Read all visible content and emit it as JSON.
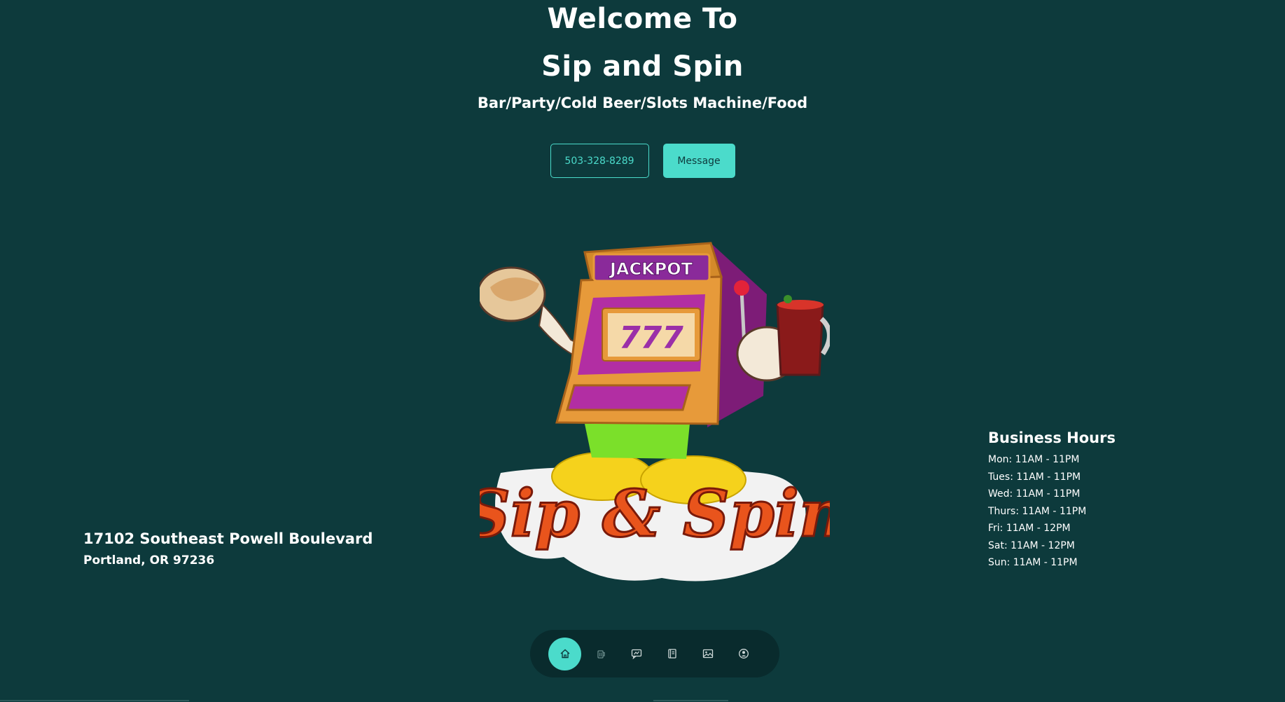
{
  "hero": {
    "title_line1": "Welcome To",
    "title_line2": "Sip and Spin",
    "subtitle": "Bar/Party/Cold Beer/Slots Machine/Food"
  },
  "cta": {
    "phone_label": "503-328-8289",
    "message_label": "Message"
  },
  "logo": {
    "marquee_text": "JACKPOT",
    "reel_text": "777",
    "wordmark": "Sip & Spin"
  },
  "address": {
    "street": "17102 Southeast Powell Boulevard",
    "city": "Portland, OR 97236"
  },
  "hours": {
    "title": "Business Hours",
    "items": [
      "Mon: 11AM - 11PM",
      "Tues: 11AM - 11PM",
      "Wed: 11AM - 11PM",
      "Thurs: 11AM - 11PM",
      "Fri: 11AM - 12PM",
      "Sat: 11AM - 12PM",
      "Sun: 11AM - 11PM"
    ]
  },
  "nav": {
    "items": [
      {
        "icon": "home-icon",
        "active": true
      },
      {
        "icon": "beer-mug-icon",
        "active": false
      },
      {
        "icon": "chat-icon",
        "active": false
      },
      {
        "icon": "menu-book-icon",
        "active": false
      },
      {
        "icon": "gallery-icon",
        "active": false
      },
      {
        "icon": "contact-icon",
        "active": false
      }
    ]
  },
  "colors": {
    "background": "#0d3a3c",
    "accent": "#4bdbcb",
    "nav_background": "#092b2d"
  }
}
